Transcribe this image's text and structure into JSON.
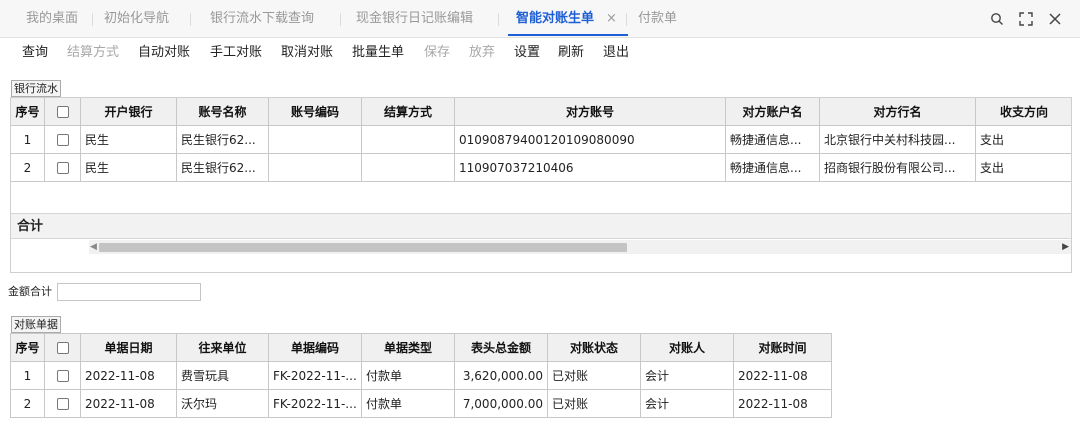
{
  "tabs": [
    {
      "label": "我的桌面"
    },
    {
      "label": "初始化导航"
    },
    {
      "label": "银行流水下载查询"
    },
    {
      "label": "现金银行日记账编辑"
    },
    {
      "label": "智能对账生单"
    },
    {
      "label": "付款单"
    }
  ],
  "tab_close_glyph": "×",
  "window_controls": {
    "search": "search-icon",
    "fullscreen": "fullscreen-icon",
    "close": "close-icon"
  },
  "toolbar": [
    {
      "label": "查询",
      "enabled": true
    },
    {
      "label": "结算方式",
      "enabled": false
    },
    {
      "label": "自动对账",
      "enabled": true
    },
    {
      "label": "手工对账",
      "enabled": true
    },
    {
      "label": "取消对账",
      "enabled": true
    },
    {
      "label": "批量生单",
      "enabled": true
    },
    {
      "label": "保存",
      "enabled": false
    },
    {
      "label": "放弃",
      "enabled": false
    },
    {
      "label": "设置",
      "enabled": true
    },
    {
      "label": "刷新",
      "enabled": true
    },
    {
      "label": "退出",
      "enabled": true
    }
  ],
  "bank_flow": {
    "section_label": "银行流水",
    "columns": [
      "序号",
      "",
      "开户银行",
      "账号名称",
      "账号编码",
      "结算方式",
      "对方账号",
      "对方账户名",
      "对方行名",
      "收支方向"
    ],
    "rows": [
      [
        "1",
        "",
        "民生",
        "民生银行62...",
        "",
        "",
        "01090879400120109080090",
        "畅捷通信息...",
        "北京银行中关村科技园...",
        "支出"
      ],
      [
        "2",
        "",
        "民生",
        "民生银行62...",
        "",
        "",
        "110907037210406",
        "畅捷通信息...",
        "招商银行股份有限公司...",
        "支出"
      ]
    ],
    "sum_label": "合计"
  },
  "amount_total": {
    "label": "金额合计",
    "value": ""
  },
  "recon_docs": {
    "section_label": "对账单据",
    "columns": [
      "序号",
      "",
      "单据日期",
      "往来单位",
      "单据编码",
      "单据类型",
      "表头总金额",
      "对账状态",
      "对账人",
      "对账时间"
    ],
    "rows": [
      [
        "1",
        "",
        "2022-11-08",
        "费雪玩具",
        "FK-2022-11-...",
        "付款单",
        "3,620,000.00",
        "已对账",
        "会计",
        "2022-11-08"
      ],
      [
        "2",
        "",
        "2022-11-08",
        "沃尔玛",
        "FK-2022-11-...",
        "付款单",
        "7,000,000.00",
        "已对账",
        "会计",
        "2022-11-08"
      ]
    ]
  }
}
